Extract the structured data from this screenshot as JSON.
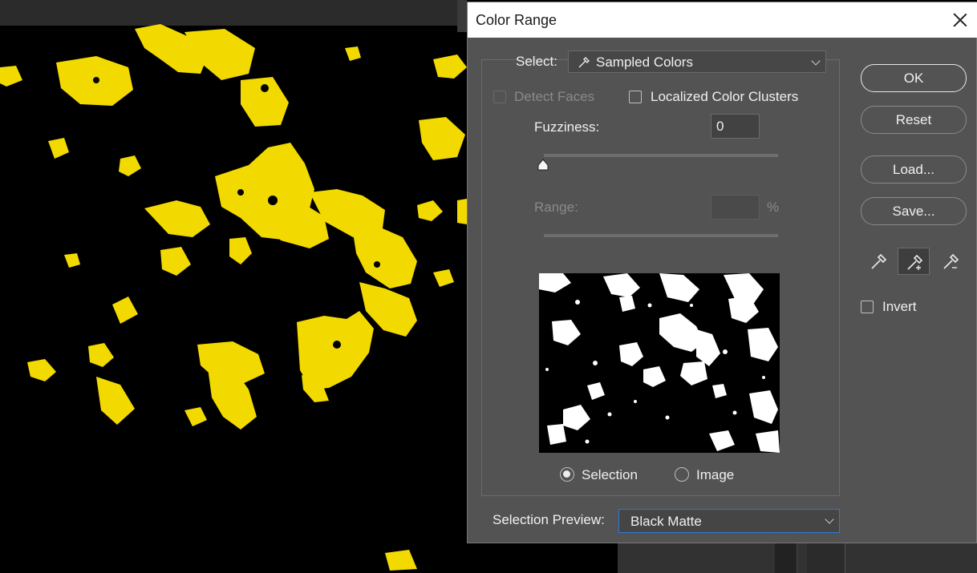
{
  "dialog": {
    "title": "Color Range",
    "select_label": "Select:",
    "select_value": "Sampled Colors",
    "detect_faces_label": "Detect Faces",
    "detect_faces_checked": false,
    "localized_label": "Localized Color Clusters",
    "localized_checked": false,
    "fuzziness_label": "Fuzziness:",
    "fuzziness_value": "0",
    "range_label": "Range:",
    "range_value": "",
    "range_unit": "%",
    "preview_mode": {
      "selection_label": "Selection",
      "image_label": "Image",
      "selected": "Selection"
    },
    "selection_preview_label": "Selection Preview:",
    "selection_preview_value": "Black Matte",
    "buttons": {
      "ok": "OK",
      "reset": "Reset",
      "load": "Load...",
      "save": "Save..."
    },
    "eyedroppers": [
      "eyedropper-icon",
      "eyedropper-plus-icon",
      "eyedropper-minus-icon"
    ],
    "active_eyedropper": "eyedropper-plus-icon",
    "invert_label": "Invert",
    "invert_checked": false
  },
  "colors": {
    "dialog_bg": "#535353",
    "selection_overlay": "#ffe500",
    "matte": "#000000",
    "focus_border": "#2d78d8"
  }
}
